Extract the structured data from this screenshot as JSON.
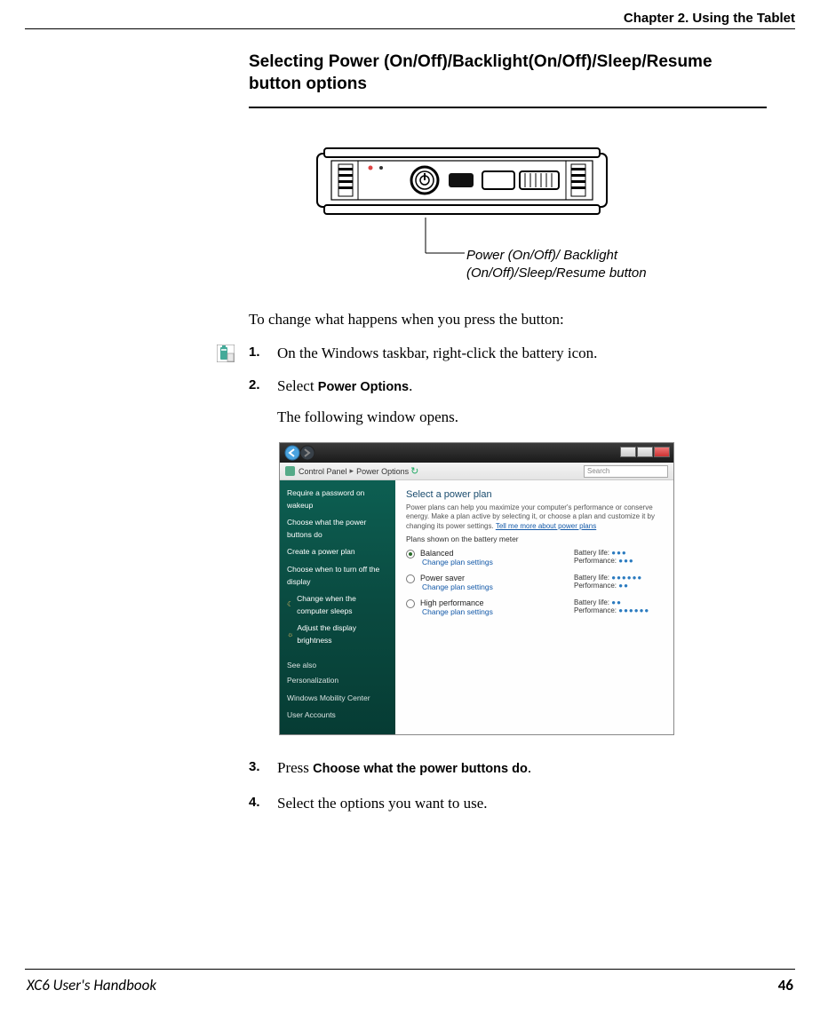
{
  "header": {
    "chapter": "Chapter 2. Using the Tablet"
  },
  "section": {
    "title": "Selecting Power (On/Off)/Backlight(On/Off)/Sleep/Resume button options"
  },
  "callout": {
    "label": "Power (On/Off)/ Backlight (On/Off)/Sleep/Resume button"
  },
  "intro": "To change what happens when you press the button:",
  "steps": {
    "s1": {
      "num": "1.",
      "text": "On the Windows taskbar, right-click the battery icon."
    },
    "s2": {
      "num": "2.",
      "pre": "Select ",
      "ui": "Power Options",
      "post": ".",
      "follow": "The following window opens."
    },
    "s3": {
      "num": "3.",
      "pre": "Press ",
      "ui": "Choose what the power buttons do",
      "post": "."
    },
    "s4": {
      "num": "4.",
      "text": "Select the options you want to use."
    }
  },
  "screenshot": {
    "breadcrumb": {
      "root": "Control Panel",
      "leaf": "Power Options",
      "search_placeholder": "Search"
    },
    "sidebar": {
      "items": [
        "Require a password on wakeup",
        "Choose what the power buttons do",
        "Create a power plan",
        "Choose when to turn off the display",
        "Change when the computer sleeps",
        "Adjust the display brightness"
      ],
      "seealso_head": "See also",
      "seealso": [
        "Personalization",
        "Windows Mobility Center",
        "User Accounts"
      ]
    },
    "main": {
      "heading": "Select a power plan",
      "desc_a": "Power plans can help you maximize your computer's performance or conserve energy. Make a plan active by selecting it, or choose a plan and customize it by changing its power settings. ",
      "desc_link": "Tell me more about power plans",
      "plan_head": "Plans shown on the battery meter",
      "plans": [
        {
          "name": "Balanced",
          "link": "Change plan settings",
          "selected": true,
          "battery": "●●●",
          "perf": "●●●"
        },
        {
          "name": "Power saver",
          "link": "Change plan settings",
          "selected": false,
          "battery": "●●●●●●",
          "perf": "●●"
        },
        {
          "name": "High performance",
          "link": "Change plan settings",
          "selected": false,
          "battery": "●●",
          "perf": "●●●●●●"
        }
      ],
      "battery_label": "Battery life:",
      "perf_label": "Performance:"
    }
  },
  "footer": {
    "book": "XC6 User's Handbook",
    "page": "46"
  }
}
